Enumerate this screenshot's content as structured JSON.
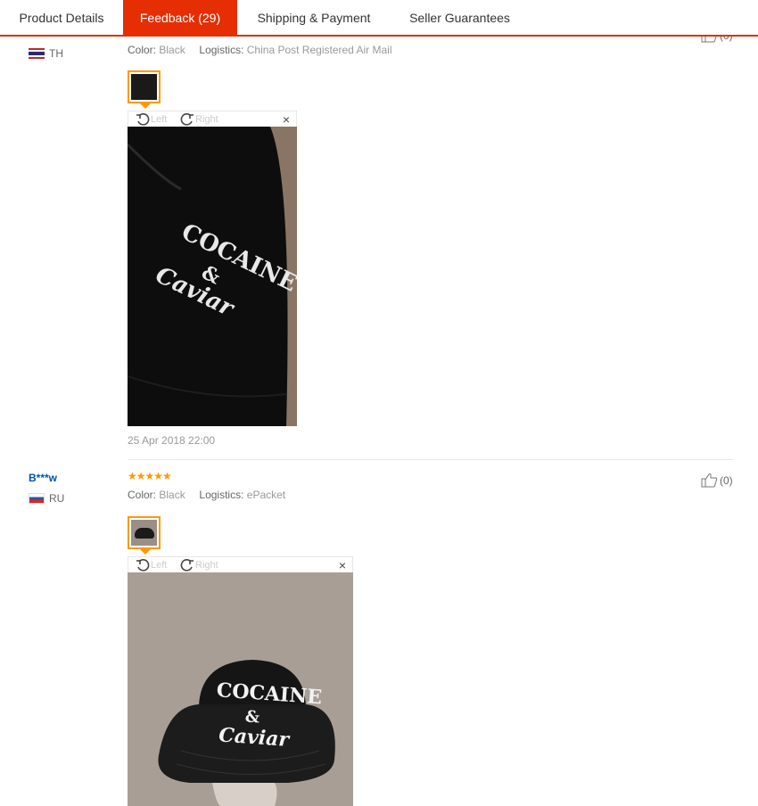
{
  "tabs": [
    {
      "label": "Product Details"
    },
    {
      "label": "Feedback (29)"
    },
    {
      "label": "Shipping & Payment"
    },
    {
      "label": "Seller Guarantees"
    }
  ],
  "feedback": [
    {
      "country": "TH",
      "color_label": "Color:",
      "color_value": "Black",
      "logistics_label": "Logistics:",
      "logistics_value": "China Post Registered Air Mail",
      "rotate_left": "Left",
      "rotate_right": "Right",
      "close": "×",
      "photo_text_line1": "COCAINE",
      "photo_text_line2": "&",
      "photo_text_line3": "Caviar",
      "date": "25 Apr 2018 22:00",
      "helpful_count": "(0)"
    },
    {
      "user": "B***w",
      "country": "RU",
      "rating": 5,
      "stars": "★★★★★",
      "color_label": "Color:",
      "color_value": "Black",
      "logistics_label": "Logistics:",
      "logistics_value": "ePacket",
      "rotate_left": "Left",
      "rotate_right": "Right",
      "close": "×",
      "photo_text_line1": "COCAINE",
      "photo_text_line2": "&",
      "photo_text_line3": "Caviar",
      "helpful_count": "(0)"
    }
  ]
}
